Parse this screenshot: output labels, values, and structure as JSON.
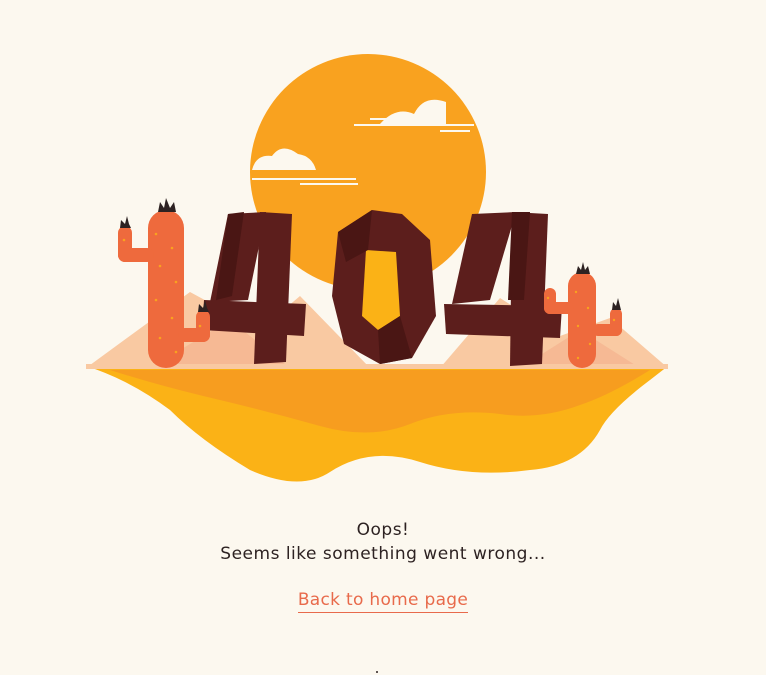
{
  "error_code": "404",
  "message": {
    "headline": "Oops!",
    "subline": "Seems like something went wrong..."
  },
  "link": {
    "label": "Back to home page"
  },
  "colors": {
    "background": "#fcf8ef",
    "sun": "#f9a21f",
    "numerals": "#5c1e1c",
    "cactus": "#ee6a3d",
    "sand": "#fba71a",
    "link": "#e86a4b"
  }
}
